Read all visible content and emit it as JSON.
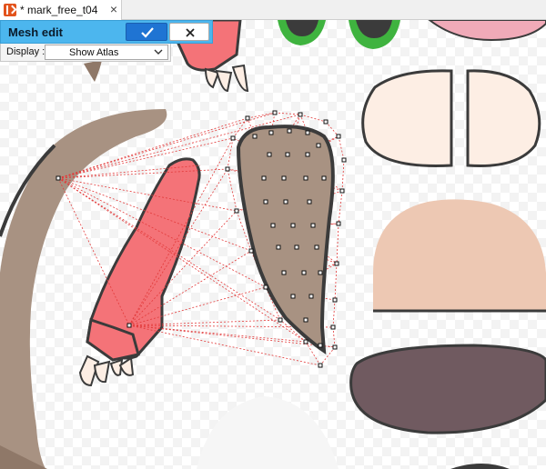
{
  "tab": {
    "title": "* mark_free_t04",
    "close_glyph": "×",
    "icon": "app-logo-icon"
  },
  "mesh_edit": {
    "title": "Mesh edit",
    "confirm_icon": "checkmark-icon",
    "cancel_icon": "close-icon"
  },
  "display": {
    "label": "Display :",
    "value": "Show Atlas",
    "chevron_icon": "chevron-down-icon"
  },
  "colors": {
    "accent_panel": "#4cb6ee",
    "confirm_button": "#1f74d3",
    "mesh_lines": "#e23a3a",
    "ear_fill": "#a89282",
    "arm_fill": "#f47378",
    "mouth_fill": "#705a60",
    "cheek_fill": "#fdeee4",
    "head_fill": "#edc8b3",
    "eye_ring": "#3fb33f"
  }
}
